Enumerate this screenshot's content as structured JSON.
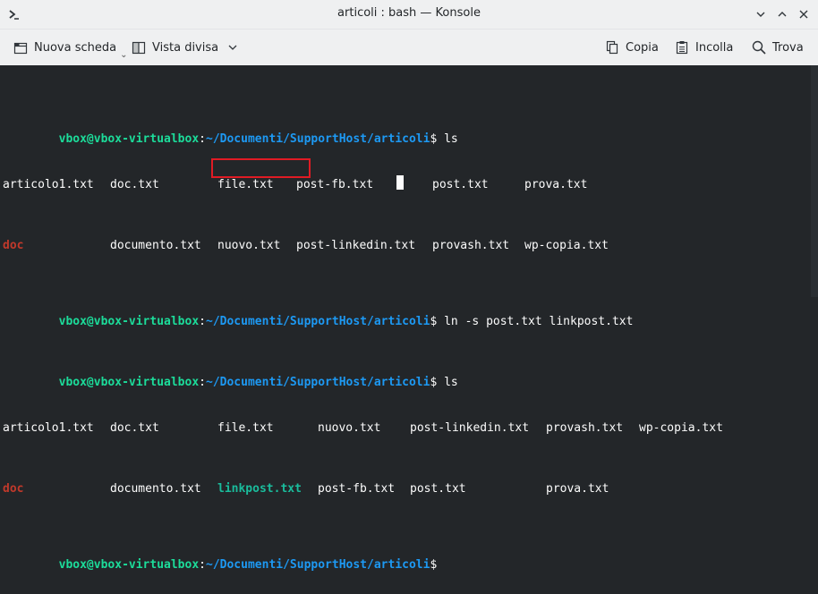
{
  "window": {
    "title": "articoli : bash — Konsole",
    "icons": [
      "terminal-app-icon",
      "minimize-icon",
      "maximize-icon",
      "close-icon"
    ]
  },
  "toolbar": {
    "new_tab": "Nuova scheda",
    "split_view": "Vista divisa",
    "copy": "Copia",
    "paste": "Incolla",
    "find": "Trova"
  },
  "prompt": {
    "user": "vbox@vbox-virtualbox",
    "sep": ":",
    "path": "~/Documenti/SupportHost/articoli",
    "symbol": "$"
  },
  "commands": [
    "ls",
    "ln -s post.txt linkpost.txt",
    "ls"
  ],
  "ls1": {
    "row1": [
      "articolo1.txt",
      "doc.txt",
      "file.txt",
      "post-fb.txt",
      "post.txt",
      "prova.txt"
    ],
    "row2": [
      "doc",
      "documento.txt",
      "nuovo.txt",
      "post-linkedin.txt",
      "provash.txt",
      "wp-copia.txt"
    ]
  },
  "ls2": {
    "row1": [
      "articolo1.txt",
      "doc.txt",
      "file.txt",
      "nuovo.txt",
      "post-linkedin.txt",
      "provash.txt",
      "wp-copia.txt"
    ],
    "row2": [
      "doc",
      "documento.txt",
      "linkpost.txt",
      "post-fb.txt",
      "post.txt",
      "prova.txt"
    ]
  },
  "colors": {
    "background": "#232629",
    "user": "#1cdc9a",
    "path": "#1d99f3",
    "directory": "#c0392b",
    "symlink": "#1abc9c",
    "highlight": "#e01b24"
  }
}
